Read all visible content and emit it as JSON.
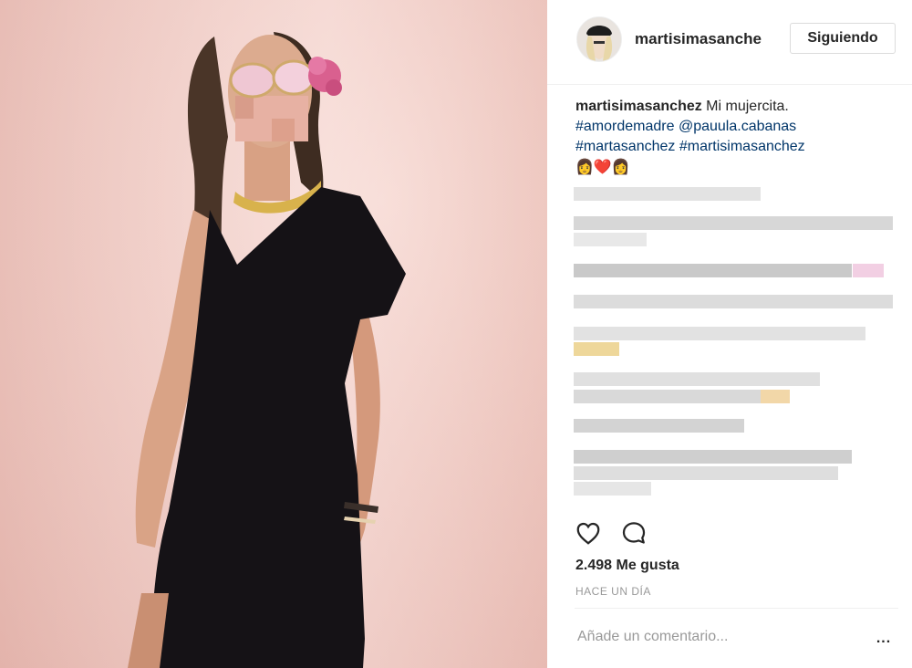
{
  "post": {
    "author_header": "martisimasanche",
    "follow_label": "Siguiendo",
    "caption_author": "martisimasanchez",
    "caption_text": " Mi mujercita.",
    "hashtag_1": "#amordemadre",
    "mention": "@pauula.cabanas",
    "hashtag_2": "#martasanchez",
    "hashtag_3": "#martisimasanchez",
    "emojis": "👩❤️👩",
    "likes": "2.498 Me gusta",
    "time": "HACE UN DÍA",
    "comment_placeholder": "Añade un comentario...",
    "more_label": "..."
  },
  "icons": {
    "like": "heart-icon",
    "comment": "comment-icon",
    "more": "more-options-icon"
  },
  "colors": {
    "link": "#003569",
    "muted": "#999999",
    "text": "#262626",
    "divider": "#efefef"
  }
}
